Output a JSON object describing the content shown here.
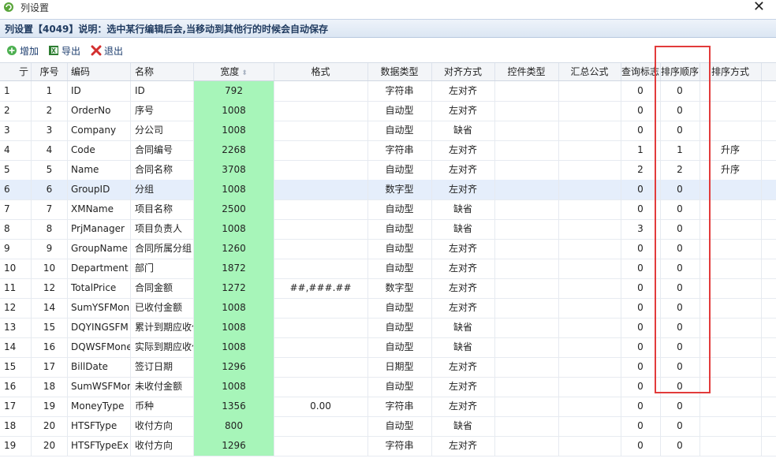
{
  "window": {
    "title": "列设置",
    "close_label": "✕"
  },
  "panel": {
    "title": "列设置【4049】说明：选中某行编辑后会,当移动到其他行的时候会自动保存"
  },
  "toolbar": {
    "add_label": "增加",
    "export_label": "导出",
    "exit_label": "退出"
  },
  "columns": {
    "rownum": "亍",
    "seq": "序号",
    "code": "编码",
    "name": "名称",
    "width": "宽度",
    "format": "格式",
    "dtype": "数据类型",
    "align": "对齐方式",
    "ctrl": "控件类型",
    "sum": "汇总公式",
    "query": "查询标志",
    "sortorder": "排序顺序",
    "sortmode": "排序方式"
  },
  "rows": [
    {
      "n": "1",
      "seq": "1",
      "code": "ID",
      "name": "ID",
      "width": "792",
      "format": "",
      "dtype": "字符串",
      "align": "左对齐",
      "query": "0",
      "sortorder": "0",
      "sortmode": ""
    },
    {
      "n": "2",
      "seq": "2",
      "code": "OrderNo",
      "name": "序号",
      "width": "1008",
      "format": "",
      "dtype": "自动型",
      "align": "左对齐",
      "query": "0",
      "sortorder": "0",
      "sortmode": ""
    },
    {
      "n": "3",
      "seq": "3",
      "code": "Company",
      "name": "分公司",
      "width": "1008",
      "format": "",
      "dtype": "自动型",
      "align": "缺省",
      "query": "0",
      "sortorder": "0",
      "sortmode": ""
    },
    {
      "n": "4",
      "seq": "4",
      "code": "Code",
      "name": "合同编号",
      "width": "2268",
      "format": "",
      "dtype": "字符串",
      "align": "左对齐",
      "query": "1",
      "sortorder": "1",
      "sortmode": "升序"
    },
    {
      "n": "5",
      "seq": "5",
      "code": "Name",
      "name": "合同名称",
      "width": "3708",
      "format": "",
      "dtype": "自动型",
      "align": "左对齐",
      "query": "2",
      "sortorder": "2",
      "sortmode": "升序"
    },
    {
      "n": "6",
      "seq": "6",
      "code": "GroupID",
      "name": "分组",
      "width": "1008",
      "format": "",
      "dtype": "数字型",
      "align": "左对齐",
      "query": "0",
      "sortorder": "0",
      "sortmode": ""
    },
    {
      "n": "7",
      "seq": "7",
      "code": "XMName",
      "name": "项目名称",
      "width": "2500",
      "format": "",
      "dtype": "自动型",
      "align": "缺省",
      "query": "0",
      "sortorder": "0",
      "sortmode": ""
    },
    {
      "n": "8",
      "seq": "8",
      "code": "PrjManager",
      "name": "项目负责人",
      "width": "1008",
      "format": "",
      "dtype": "自动型",
      "align": "缺省",
      "query": "3",
      "sortorder": "0",
      "sortmode": ""
    },
    {
      "n": "9",
      "seq": "9",
      "code": "GroupName",
      "name": "合同所属分组",
      "width": "1260",
      "format": "",
      "dtype": "自动型",
      "align": "左对齐",
      "query": "0",
      "sortorder": "0",
      "sortmode": ""
    },
    {
      "n": "10",
      "seq": "10",
      "code": "Department",
      "name": "部门",
      "width": "1872",
      "format": "",
      "dtype": "自动型",
      "align": "左对齐",
      "query": "0",
      "sortorder": "0",
      "sortmode": ""
    },
    {
      "n": "11",
      "seq": "12",
      "code": "TotalPrice",
      "name": "合同金额",
      "width": "1272",
      "format": "##,###.##",
      "dtype": "数字型",
      "align": "左对齐",
      "query": "0",
      "sortorder": "0",
      "sortmode": ""
    },
    {
      "n": "12",
      "seq": "14",
      "code": "SumYSFMon",
      "name": "已收付金额",
      "width": "1008",
      "format": "",
      "dtype": "自动型",
      "align": "左对齐",
      "query": "0",
      "sortorder": "0",
      "sortmode": ""
    },
    {
      "n": "13",
      "seq": "15",
      "code": "DQYINGSFM",
      "name": "累计到期应收付",
      "width": "1008",
      "format": "",
      "dtype": "自动型",
      "align": "缺省",
      "query": "0",
      "sortorder": "0",
      "sortmode": ""
    },
    {
      "n": "14",
      "seq": "16",
      "code": "DQWSFMone",
      "name": "实际到期应收付",
      "width": "1008",
      "format": "",
      "dtype": "自动型",
      "align": "缺省",
      "query": "0",
      "sortorder": "0",
      "sortmode": ""
    },
    {
      "n": "15",
      "seq": "17",
      "code": "BillDate",
      "name": "签订日期",
      "width": "1296",
      "format": "",
      "dtype": "日期型",
      "align": "左对齐",
      "query": "0",
      "sortorder": "0",
      "sortmode": ""
    },
    {
      "n": "16",
      "seq": "18",
      "code": "SumWSFMor",
      "name": "未收付金额",
      "width": "1008",
      "format": "",
      "dtype": "自动型",
      "align": "左对齐",
      "query": "0",
      "sortorder": "0",
      "sortmode": ""
    },
    {
      "n": "17",
      "seq": "19",
      "code": "MoneyType",
      "name": "币种",
      "width": "1356",
      "format": "0.00",
      "dtype": "字符串",
      "align": "左对齐",
      "query": "0",
      "sortorder": "0",
      "sortmode": ""
    },
    {
      "n": "18",
      "seq": "20",
      "code": "HTSFType",
      "name": "收付方向",
      "width": "800",
      "format": "",
      "dtype": "自动型",
      "align": "缺省",
      "query": "0",
      "sortorder": "0",
      "sortmode": ""
    },
    {
      "n": "19",
      "seq": "20",
      "code": "HTSFTypeEx",
      "name": "收付方向",
      "width": "1296",
      "format": "",
      "dtype": "字符串",
      "align": "左对齐",
      "query": "0",
      "sortorder": "0",
      "sortmode": ""
    }
  ],
  "selected_row_index": 5,
  "colors": {
    "width_column": "#a7f5b9",
    "highlight_box": "#e23b3b",
    "selected_row": "#e5eefb"
  }
}
